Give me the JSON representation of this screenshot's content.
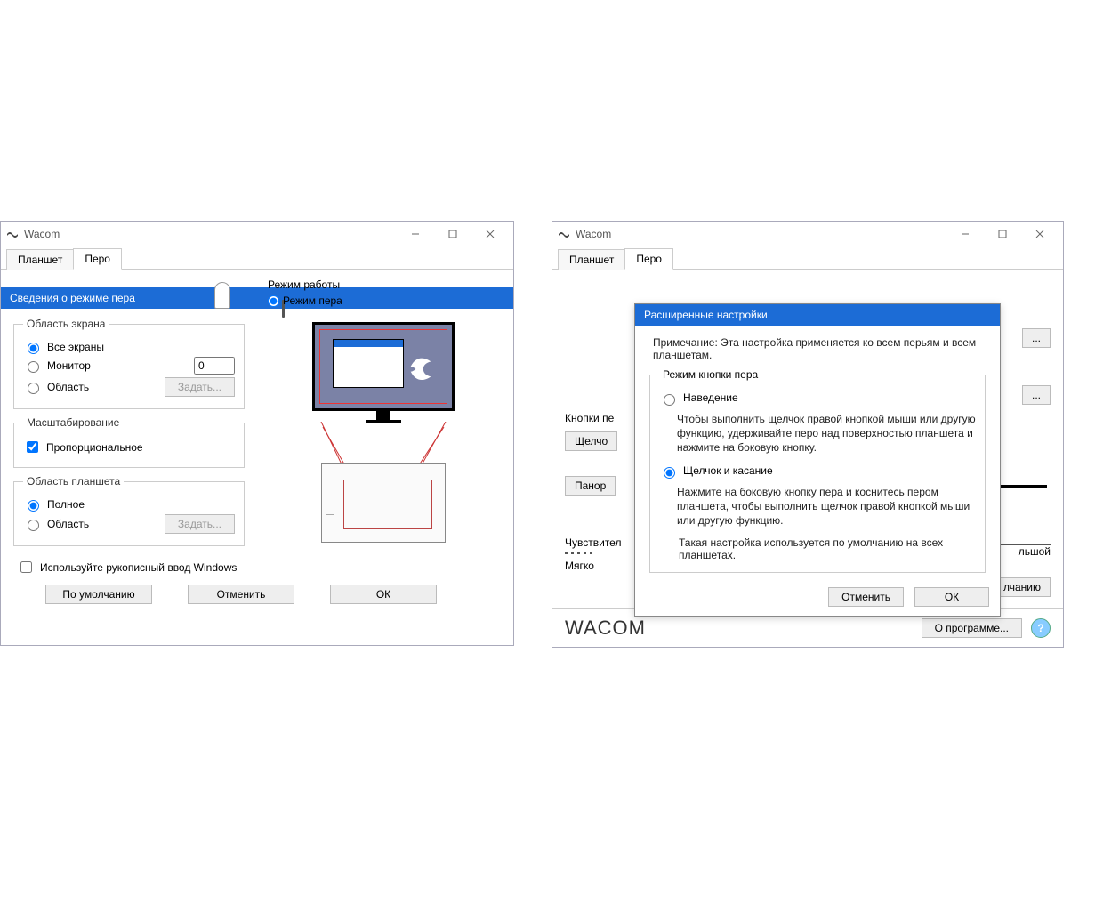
{
  "left": {
    "app_title": "Wacom",
    "tabs": {
      "tablet": "Планшет",
      "pen": "Перо"
    },
    "mode": {
      "title": "Режим работы",
      "pen_mode": "Режим пера"
    },
    "dialog_title": "Сведения о режиме пера",
    "screen_area": {
      "legend": "Область экрана",
      "all_screens": "Все экраны",
      "monitor": "Монитор",
      "region": "Область",
      "monitor_index": "0",
      "set_btn": "Задать..."
    },
    "scaling": {
      "legend": "Масштабирование",
      "proportional": "Пропорциональное"
    },
    "tablet_area": {
      "legend": "Область планшета",
      "full": "Полное",
      "region": "Область",
      "set_btn": "Задать..."
    },
    "use_ink": "Используйте рукописный ввод Windows",
    "buttons": {
      "defaults": "По умолчанию",
      "cancel": "Отменить",
      "ok": "ОК"
    }
  },
  "right": {
    "app_title": "Wacom",
    "tabs": {
      "tablet": "Планшет",
      "pen": "Перо"
    },
    "bg": {
      "buttons_pen": "Кнопки пе",
      "btn_click": "Щелчо",
      "btn_pan": "Панор",
      "sensitivity": "Чувствител",
      "soft": "Мягко",
      "big_suffix": "льшой",
      "reset_suffix": "лчанию"
    },
    "adv": {
      "title": "Расширенные настройки",
      "note": "Примечание: Эта настройка применяется ко всем перьям и всем планшетам.",
      "group_title": "Режим кнопки пера",
      "hover": "Наведение",
      "hover_desc": "Чтобы выполнить щелчок правой кнопкой мыши или другую функцию, удерживайте перо над поверхностью планшета и нажмите на боковую кнопку.",
      "click_touch": "Щелчок и касание",
      "click_touch_desc": "Нажмите на боковую кнопку пера и коснитесь пером планшета, чтобы выполнить щелчок правой кнопкой мыши или другую функцию.",
      "default_note": "Такая настройка используется по умолчанию на всех планшетах.",
      "cancel": "Отменить",
      "ok": "ОК"
    },
    "footer": {
      "logo": "WACOM",
      "about": "О программе..."
    }
  }
}
